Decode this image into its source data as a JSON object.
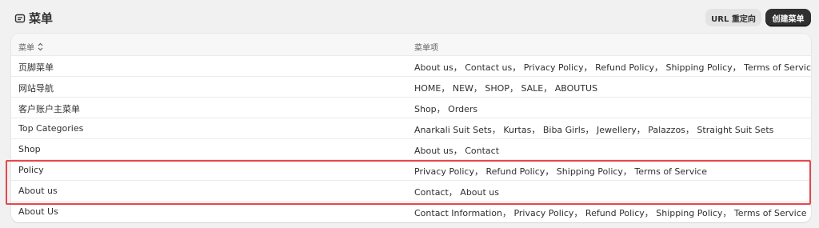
{
  "header": {
    "title": "菜单",
    "title_icon": "menu-box-icon",
    "redirect_button": "URL 重定向",
    "create_button": "创建菜单"
  },
  "table": {
    "columns": [
      "菜单",
      "菜单项"
    ],
    "rows": [
      {
        "name": "页脚菜单",
        "items": "About us， Contact us， Privacy Policy， Refund Policy， Shipping Policy， Terms of Service"
      },
      {
        "name": "网站导航",
        "items": "HOME， NEW， SHOP， SALE， ABOUTUS"
      },
      {
        "name": "客户账户主菜单",
        "items": "Shop， Orders"
      },
      {
        "name": "Top Categories",
        "items": "Anarkali Suit Sets， Kurtas， Biba Girls， Jewellery， Palazzos， Straight Suit Sets"
      },
      {
        "name": "Shop",
        "items": "About us， Contact"
      },
      {
        "name": "Policy",
        "items": "Privacy Policy， Refund Policy， Shipping Policy， Terms of Service"
      },
      {
        "name": "About us",
        "items": "Contact， About us"
      },
      {
        "name": "About Us",
        "items": "Contact Information， Privacy Policy， Refund Policy， Shipping Policy， Terms of Service"
      }
    ]
  },
  "colors": {
    "highlight": "#e5484d",
    "primary_button": "#303030"
  }
}
